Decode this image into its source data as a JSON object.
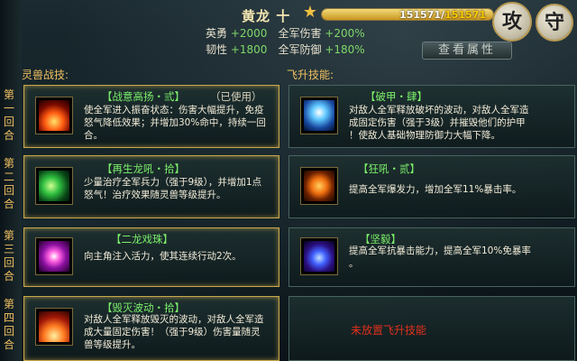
{
  "hero": {
    "name": "黄龙 十",
    "hp_current": "151571",
    "hp_sep": "/",
    "hp_max": "151571",
    "hp_fraction": 1.0
  },
  "stats": {
    "row1": {
      "label1": "英勇",
      "value1": "+2000",
      "label2": "全军伤害",
      "value2": "+200%"
    },
    "row2": {
      "label1": "韧性",
      "value1": "+1800",
      "label2": "全军防御",
      "value2": "+180%"
    }
  },
  "buttons": {
    "attack": "攻",
    "defense": "守",
    "view_attr": "查看属性"
  },
  "sections": {
    "beast_skills": "灵兽战技:",
    "ascend_skills": "飞升技能:"
  },
  "rows": [
    {
      "label": "第一回合"
    },
    {
      "label": "第二回合"
    },
    {
      "label": "第三回合"
    },
    {
      "label": "第四回合"
    }
  ],
  "beast_skills": [
    {
      "name": "【战意高扬・弎】",
      "used": "（已使用）",
      "desc_lines": [
        "使全军进入振奋状态：伤害大幅提升，免疫",
        "怒气降低效果；并增加30%命中，持续一回",
        "合。"
      ],
      "icon": "flame-warrior-icon"
    },
    {
      "name": "【再生龙吼・拾】",
      "desc_lines": [
        "少量治疗全军兵力（强于9级），并增加1点",
        "怒气！治疗效果随灵兽等级提升。"
      ],
      "icon": "green-dragon-icon"
    },
    {
      "name": "【二龙戏珠】",
      "desc_lines": [
        "向主角注入活力，使其连续行动2次。"
      ],
      "icon": "pearl-icon"
    },
    {
      "name": "【毁灭波动・拾】",
      "desc_lines": [
        "对敌人全军释放毁灭的波动，对敌人全军造",
        "成大量固定伤害！（强于9级）伤害量随灵",
        "兽等级提升。"
      ],
      "icon": "destruction-wave-icon"
    }
  ],
  "ascend_skills": [
    {
      "name": "【破甲・肆】",
      "desc_lines": [
        "对敌人全军释放破坏的波动，对敌人全军造",
        "成固定伤害（强于3级）并摧毁他们的护甲",
        "！使敌人基础物理防御力大幅下降。"
      ],
      "icon": "armor-break-icon"
    },
    {
      "name": "【狂吼・贰】",
      "desc_lines": [
        "提高全军爆发力，增加全军11%暴击率。"
      ],
      "icon": "roaring-beast-icon"
    },
    {
      "name": "【坚毅】",
      "desc_lines": [
        "提高全军抗暴击能力，提高全军10%免暴率",
        "。"
      ],
      "icon": "meditation-icon"
    },
    {
      "empty": "未放置飞升技能"
    }
  ],
  "colors": {
    "skill_name": "#7cf06a",
    "bonus_value": "#7fd86a",
    "section_title": "#f0c060",
    "empty_text": "#e0301c"
  }
}
